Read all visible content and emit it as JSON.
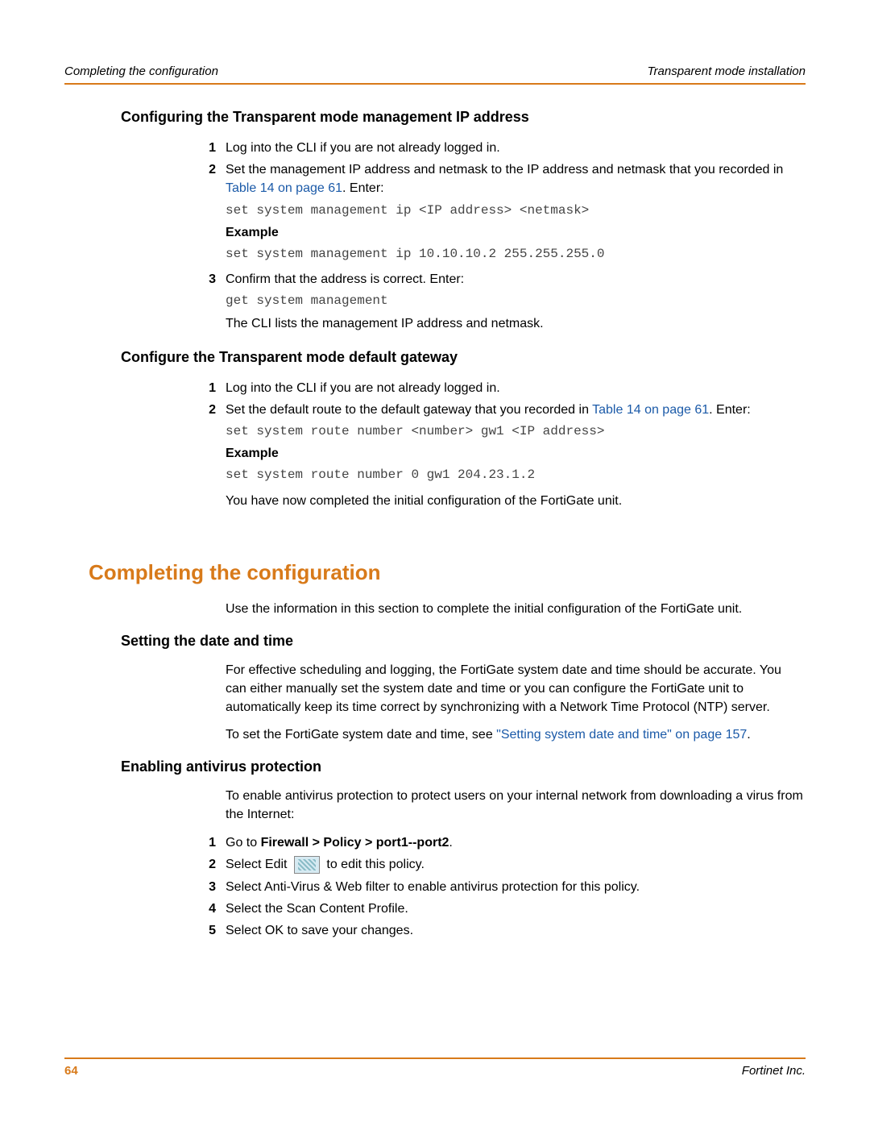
{
  "header": {
    "left": "Completing the configuration",
    "right": "Transparent mode installation"
  },
  "section1": {
    "title": "Configuring the Transparent mode management IP address",
    "steps": {
      "s1": "Log into the CLI if you are not already logged in.",
      "s2_a": "Set the management IP address and netmask to the IP address and netmask that you recorded in ",
      "s2_link": "Table 14 on page 61",
      "s2_b": ". Enter:",
      "s2_code1": "set system management ip <IP address> <netmask>",
      "s2_example_label": "Example",
      "s2_code2": "set system management ip 10.10.10.2 255.255.255.0",
      "s3_a": "Confirm that the address is correct. Enter:",
      "s3_code": "get system management",
      "s3_b": "The CLI lists the management IP address and netmask."
    }
  },
  "section2": {
    "title": "Configure the Transparent mode default gateway",
    "steps": {
      "s1": "Log into the CLI if you are not already logged in.",
      "s2_a": "Set the default route to the default gateway that you recorded in ",
      "s2_link": "Table 14 on page 61",
      "s2_b": ". Enter:",
      "s2_code1": "set system route number <number> gw1 <IP address>",
      "s2_example_label": "Example",
      "s2_code2": "set system route number 0 gw1 204.23.1.2",
      "s2_c": "You have now completed the initial configuration of the FortiGate unit."
    }
  },
  "main_heading": "Completing the configuration",
  "intro_p": "Use the information in this section to complete the initial configuration of the FortiGate unit.",
  "section3": {
    "title": "Setting the date and time",
    "p1": "For effective scheduling and logging, the FortiGate system date and time should be accurate. You can either manually set the system date and time or you can configure the FortiGate unit to automatically keep its time correct by synchronizing with a Network Time Protocol (NTP) server.",
    "p2_a": "To set the FortiGate system date and time, see ",
    "p2_link": "\"Setting system date and time\" on page 157",
    "p2_b": "."
  },
  "section4": {
    "title": "Enabling antivirus protection",
    "intro": "To enable antivirus protection to protect users on your internal network from downloading a virus from the Internet:",
    "steps": {
      "s1_a": "Go to ",
      "s1_bold": "Firewall > Policy > port1--port2",
      "s1_b": ".",
      "s2_a": "Select Edit ",
      "s2_b": " to edit this policy.",
      "s3": "Select Anti-Virus & Web filter to enable antivirus protection for this policy.",
      "s4": "Select the Scan Content Profile.",
      "s5": "Select OK to save your changes."
    }
  },
  "footer": {
    "page": "64",
    "vendor": "Fortinet Inc."
  }
}
